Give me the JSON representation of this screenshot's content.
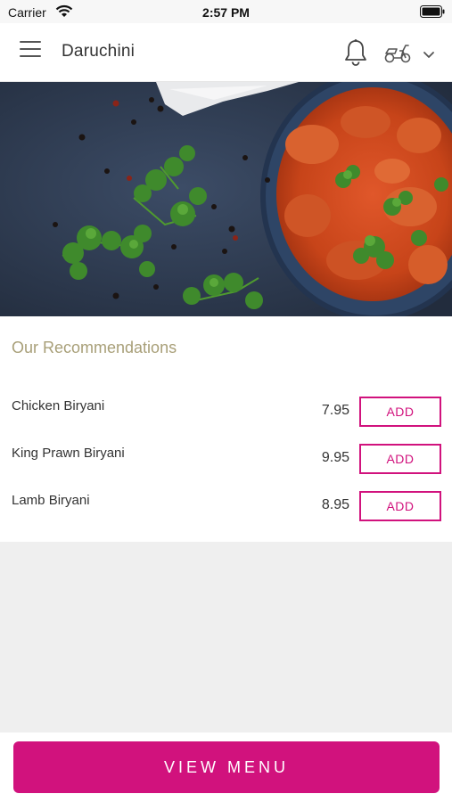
{
  "status_bar": {
    "carrier": "Carrier",
    "time": "2:57 PM"
  },
  "header": {
    "title": "Daruchini"
  },
  "recommendations": {
    "title": "Our Recommendations",
    "items": [
      {
        "name": "Chicken Biryani",
        "price": "7.95",
        "button": "ADD"
      },
      {
        "name": "King Prawn Biryani",
        "price": "9.95",
        "button": "ADD"
      },
      {
        "name": "Lamb Biryani",
        "price": "8.95",
        "button": "ADD"
      }
    ]
  },
  "footer": {
    "view_menu_label": "VIEW MENU"
  },
  "colors": {
    "accent": "#d1127d",
    "section_title": "#a89f78",
    "background": "#efefef"
  }
}
